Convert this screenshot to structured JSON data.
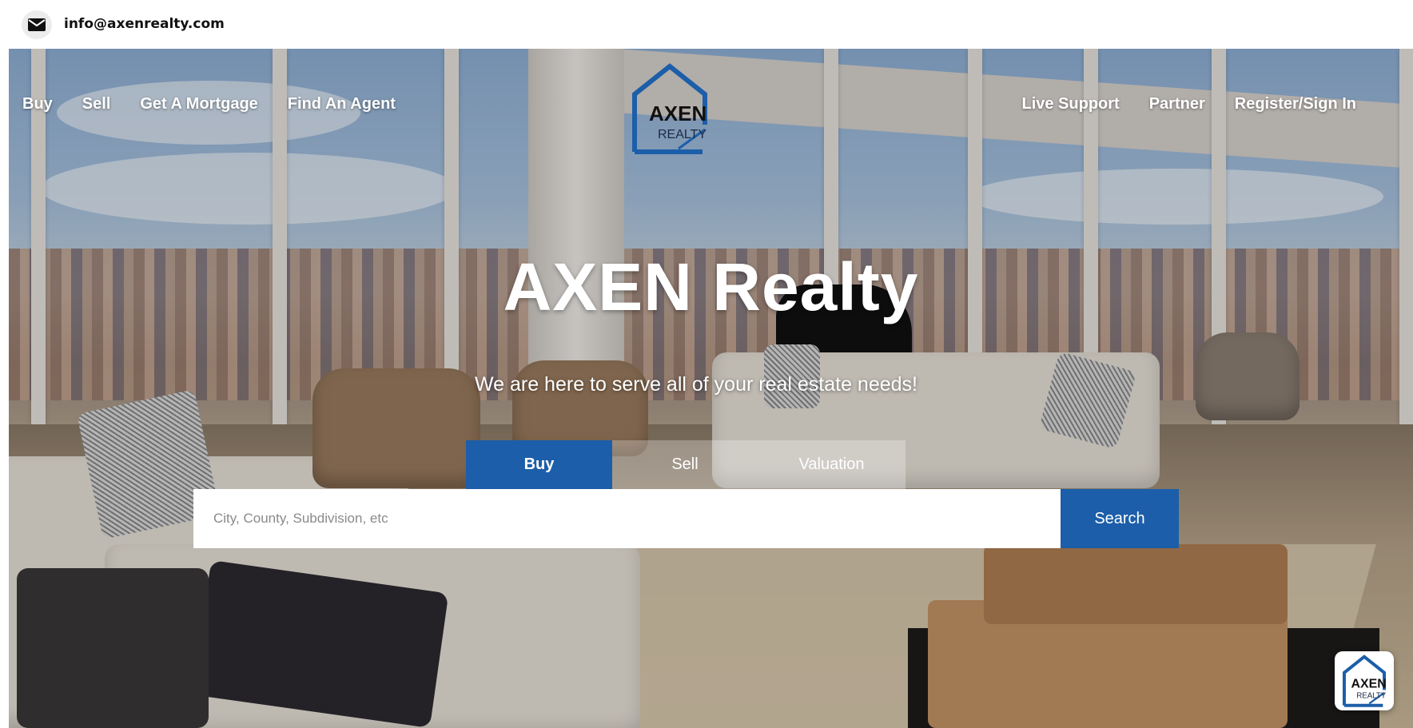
{
  "topbar": {
    "email": "info@axenrealty.com",
    "mail_icon": "envelope-icon"
  },
  "nav": {
    "left": [
      {
        "label": "Buy"
      },
      {
        "label": "Sell"
      },
      {
        "label": "Get A Mortgage"
      },
      {
        "label": "Find An Agent"
      }
    ],
    "right": [
      {
        "label": "Live Support"
      },
      {
        "label": "Partner"
      },
      {
        "label": "Register/Sign In"
      }
    ]
  },
  "logo": {
    "line1": "AXEN",
    "line2": "REALTY"
  },
  "hero": {
    "title": "AXEN Realty",
    "subtitle": "We are here to serve all of your real estate needs!"
  },
  "search": {
    "tabs": [
      {
        "label": "Buy",
        "active": true
      },
      {
        "label": "Sell",
        "active": false
      },
      {
        "label": "Valuation",
        "active": false
      }
    ],
    "placeholder": "City, County, Subdivision, etc",
    "button_label": "Search"
  },
  "colors": {
    "brand_blue": "#1c5ea9",
    "white": "#ffffff"
  }
}
